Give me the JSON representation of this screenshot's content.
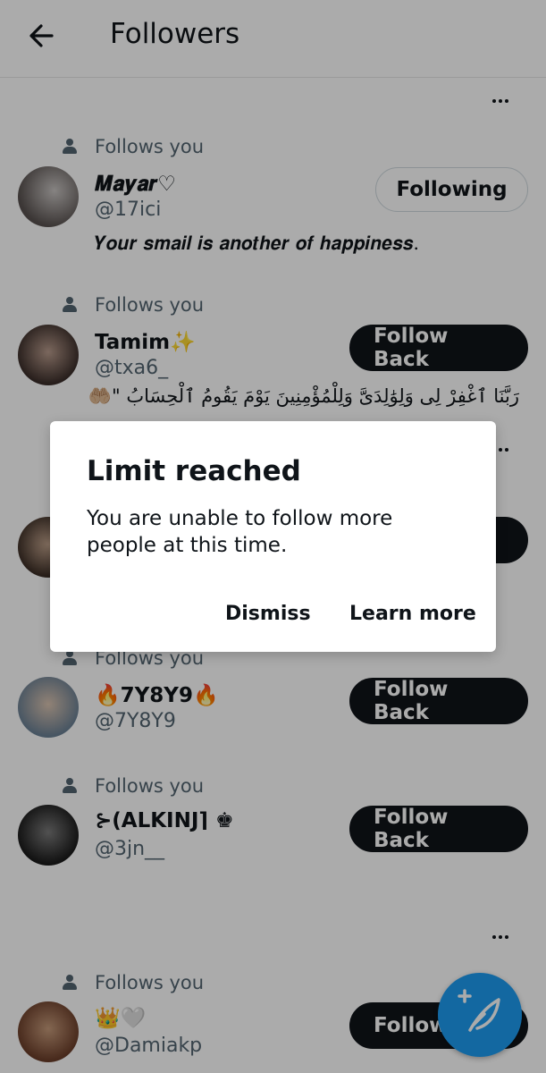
{
  "header": {
    "title": "Followers",
    "back_icon": "arrow-left-icon"
  },
  "followers": [
    {
      "follows_text": "Follows you",
      "name": "𝑴𝒂𝒚𝒂𝒓♡",
      "handle": "@17ici",
      "bio": "𝒀𝒐𝒖𝒓 𝒔𝒎𝒂𝒊𝒍 𝒊𝒔 𝒂𝒏𝒐𝒕𝒉𝒆𝒓 𝒐𝒇 𝒉𝒂𝒑𝒑𝒊𝒏𝒆𝒔𝒔.",
      "button": "Following"
    },
    {
      "follows_text": "Follows you",
      "name": "Tamim✨",
      "handle": "@txa6_",
      "bio": "رَبَّنَا ٱغْفِرْ لِى وَلِوَٰلِدَىَّ وَلِلْمُؤْمِنِينَ يَوْمَ يَقُومُ ٱلْحِسَابُ \"🤲🏼",
      "button": "Follow Back"
    },
    {
      "follows_text": "Follows you",
      "name": "🔥7Y8Y9🔥",
      "handle": "@7Y8Y9",
      "button": "Follow Back"
    },
    {
      "follows_text": "Follows you",
      "name": "⊱(ALKINJ⌉ ♚",
      "handle": "@3jn__",
      "button": "Follow Back"
    },
    {
      "follows_text": "Follows you",
      "name": "👑🤍",
      "handle": "@Damiakp",
      "button": "Follow"
    }
  ],
  "dialog": {
    "title": "Limit reached",
    "message": "You are unable to follow more people at this time.",
    "dismiss": "Dismiss",
    "learn_more": "Learn more"
  },
  "fab": {
    "icon": "compose-feather-icon",
    "color": "#1d9bf0"
  },
  "colors": {
    "overlay": "rgba(0,0,0,0.33)",
    "primary_text": "#0f1419",
    "secondary_text": "#536471"
  }
}
